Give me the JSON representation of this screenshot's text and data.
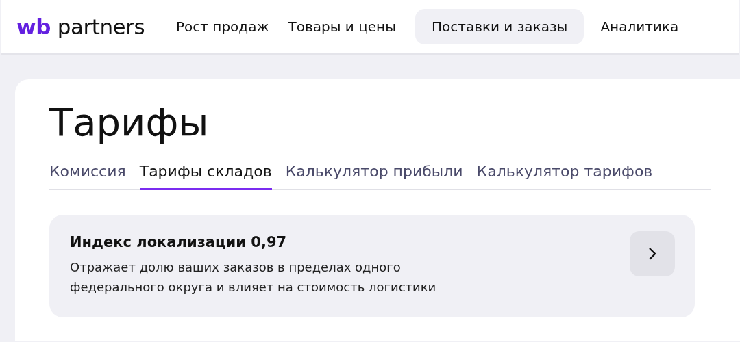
{
  "logo": {
    "brand": "wb",
    "name": "partners"
  },
  "nav": [
    {
      "label": "Рост продаж",
      "selected": false
    },
    {
      "label": "Товары и цены",
      "selected": false
    },
    {
      "label": "Поставки и заказы",
      "selected": true
    },
    {
      "label": "Аналитика",
      "selected": false
    }
  ],
  "page": {
    "title": "Тарифы",
    "tabs": [
      {
        "label": "Комиссия",
        "selected": false
      },
      {
        "label": "Тарифы складов",
        "selected": true
      },
      {
        "label": "Калькулятор прибыли",
        "selected": false
      },
      {
        "label": "Калькулятор тарифов",
        "selected": false
      }
    ],
    "info_card": {
      "title": "Индекс локализации 0,97",
      "text": "Отражает долю ваших заказов в пределах одного федерального округа и влияет на стоимость логистики"
    }
  }
}
